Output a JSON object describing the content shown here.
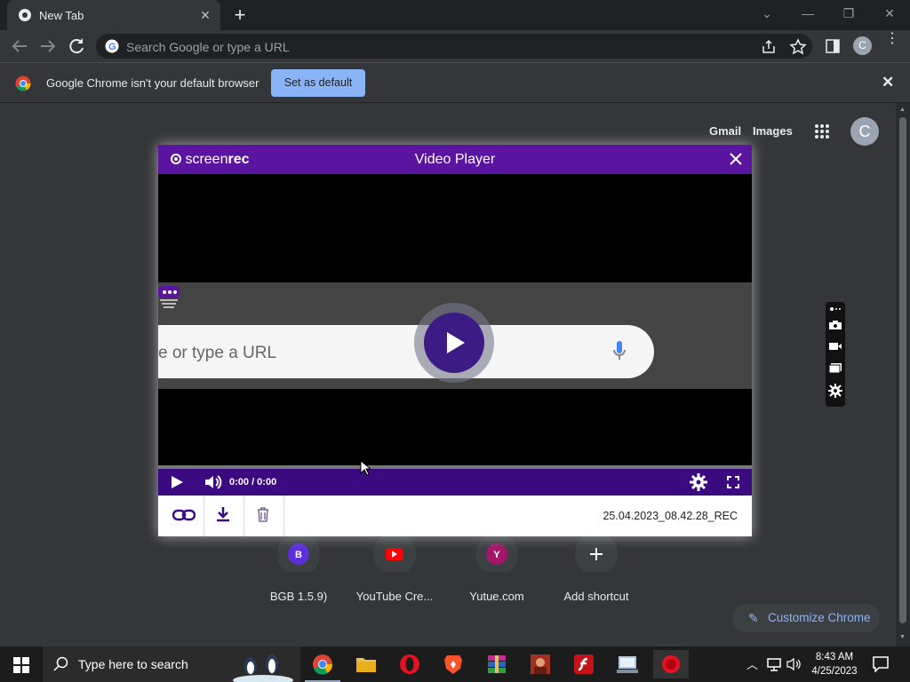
{
  "browser": {
    "tab_title": "New Tab",
    "omnibox_placeholder": "Search Google or type a URL",
    "profile_letter": "C"
  },
  "infobar": {
    "message": "Google Chrome isn't your default browser",
    "button": "Set as default"
  },
  "ntp": {
    "links": [
      "Gmail",
      "Images"
    ],
    "avatar_letter": "C",
    "shortcuts": [
      {
        "letter": "B",
        "label": "BGB 1.5.9)",
        "color": "#5b2fd9"
      },
      {
        "letter": "",
        "label": "YouTube Cre...",
        "color": "#ff0000"
      },
      {
        "letter": "Y",
        "label": "Yutue.com",
        "color": "#a4166a"
      },
      {
        "letter": "+",
        "label": "Add shortcut",
        "color": "#3c4043"
      }
    ],
    "customize_label": "Customize Chrome"
  },
  "player": {
    "brand_a": "screen",
    "brand_b": "rec",
    "title": "Video Player",
    "frame_text": "e or type a URL",
    "time": "0:00 / 0:00",
    "filename": "25.04.2023_08.42.28_REC"
  },
  "taskbar": {
    "search_placeholder": "Type here to search",
    "time": "8:43 AM",
    "date": "4/25/2023"
  }
}
